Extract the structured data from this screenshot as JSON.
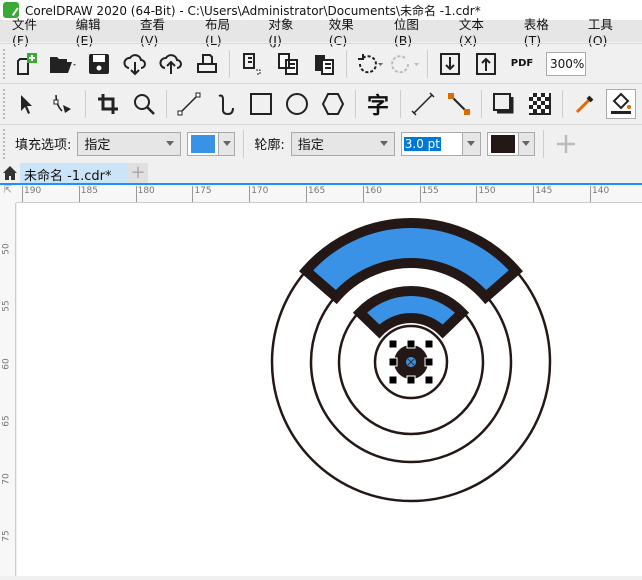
{
  "title": "CorelDRAW 2020 (64-Bit) - C:\\Users\\Administrator\\Documents\\未命名 -1.cdr*",
  "menu": [
    "文件(F)",
    "编辑(E)",
    "查看(V)",
    "布局(L)",
    "对象(J)",
    "效果(C)",
    "位图(B)",
    "文本(X)",
    "表格(T)",
    "工具(O)"
  ],
  "toolbar": {
    "zoom": "300%",
    "pdf": "PDF"
  },
  "property_bar": {
    "fill_label": "填充选项:",
    "fill_value": "指定",
    "fill_color": "#3a92e6",
    "outline_label": "轮廓:",
    "outline_value": "指定",
    "outline_width": "3.0 pt",
    "outline_color": "#231815"
  },
  "tabs": {
    "doc": "未命名 -1.cdr*",
    "add": "+"
  },
  "ruler": {
    "h": [
      "190",
      "185",
      "180",
      "175",
      "170",
      "165",
      "160",
      "155",
      "150",
      "145",
      "140"
    ],
    "v": [
      "50",
      "55",
      "60",
      "65",
      "70",
      "75"
    ]
  },
  "colors": {
    "blue": "#3a92e6",
    "dark": "#231815"
  }
}
